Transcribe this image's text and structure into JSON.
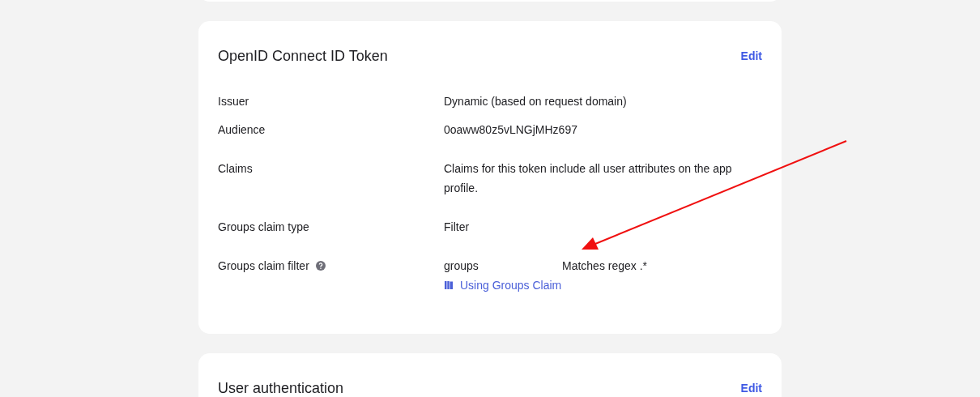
{
  "cards": [
    {
      "title": "OpenID Connect ID Token",
      "edit": "Edit",
      "rows": [
        {
          "label": "Issuer",
          "value": "Dynamic (based on request domain)"
        },
        {
          "label": "Audience",
          "value": "0oaww80z5vLNGjMHz697"
        },
        {
          "label": "Claims",
          "value": "Claims for this token include all user attributes on the app profile."
        },
        {
          "label": "Groups claim type",
          "value": "Filter"
        },
        {
          "label": "Groups claim filter",
          "help": true,
          "value": "groups",
          "value_2": "Matches regex .*",
          "link": "Using Groups Claim"
        }
      ]
    },
    {
      "title": "User authentication",
      "edit": "Edit"
    }
  ]
}
